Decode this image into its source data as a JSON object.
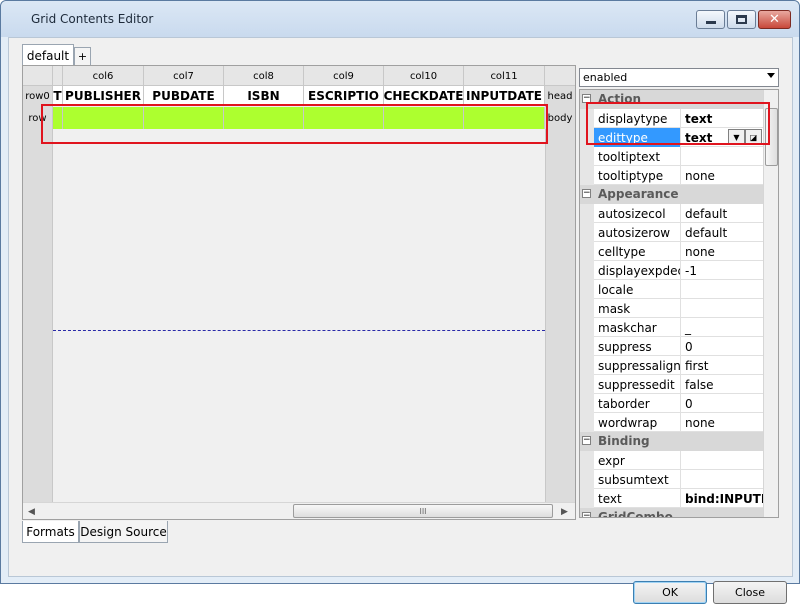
{
  "window": {
    "title": "Grid Contents Editor"
  },
  "tabs": {
    "default_label": "default",
    "add_label": "+"
  },
  "grid": {
    "columns": [
      "col6",
      "col7",
      "col8",
      "col9",
      "col10",
      "col11"
    ],
    "row0_label": "row0",
    "row0_first": "T",
    "row0_cells": [
      "PUBLISHER",
      "PUBDATE",
      "ISBN",
      "ESCRIPTIO",
      "CHECKDATE",
      "INPUTDATE"
    ],
    "row1_label": "row",
    "row0_right": "head",
    "row1_right": "body",
    "row1_highlight_color": "#adff2f",
    "scroll_thumb_glyph": "III",
    "scroll_left_glyph": "◀",
    "scroll_right_glyph": "▶"
  },
  "bottom_tabs": {
    "formats": "Formats",
    "design_source": "Design Source"
  },
  "properties": {
    "dropdown_value": "enabled",
    "categories": {
      "action": "Action",
      "appearance": "Appearance",
      "binding": "Binding",
      "gridcombo": "GridCombo"
    },
    "action_rows": [
      {
        "name": "displaytype",
        "value": "text"
      },
      {
        "name": "edittype",
        "value": "text"
      },
      {
        "name": "tooltiptext",
        "value": ""
      },
      {
        "name": "tooltiptype",
        "value": "none"
      }
    ],
    "appearance_rows": [
      {
        "name": "autosizecol",
        "value": "default"
      },
      {
        "name": "autosizerow",
        "value": "default"
      },
      {
        "name": "celltype",
        "value": "none"
      },
      {
        "name": "displayexpdec",
        "value": "-1"
      },
      {
        "name": "locale",
        "value": ""
      },
      {
        "name": "mask",
        "value": ""
      },
      {
        "name": "maskchar",
        "value": "_"
      },
      {
        "name": "suppress",
        "value": "0"
      },
      {
        "name": "suppressalign",
        "value": "first"
      },
      {
        "name": "suppressedit",
        "value": "false"
      },
      {
        "name": "taborder",
        "value": "0"
      },
      {
        "name": "wordwrap",
        "value": "none"
      }
    ],
    "binding_rows": [
      {
        "name": "expr",
        "value": ""
      },
      {
        "name": "subsumtext",
        "value": ""
      },
      {
        "name": "text",
        "value": "bind:INPUTDA"
      }
    ],
    "toggle_glyph": "−"
  },
  "buttons": {
    "ok": "OK",
    "close": "Close"
  },
  "colors": {
    "highlight_red": "#e0141e",
    "selection_blue": "#3399ff"
  }
}
